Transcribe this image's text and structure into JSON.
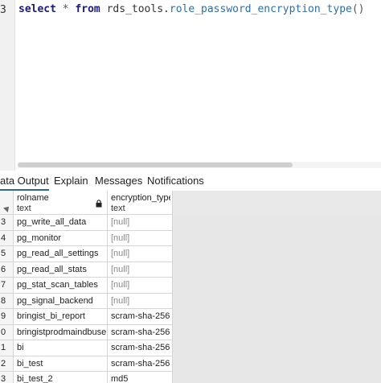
{
  "editor": {
    "line_number": "3",
    "code": {
      "kw_select": "select",
      "star": "*",
      "kw_from": "from",
      "schema": "rds_tools.",
      "func": "role_password_encryption_type",
      "parens": "()"
    }
  },
  "tabs": [
    {
      "label": "ata Output",
      "active": true
    },
    {
      "label": "Explain",
      "active": false
    },
    {
      "label": "Messages",
      "active": false
    },
    {
      "label": "Notifications",
      "active": false
    }
  ],
  "grid": {
    "columns": [
      {
        "name": "rolname",
        "type": "text"
      },
      {
        "name": "encryption_type",
        "type": "text"
      }
    ],
    "rows": [
      {
        "num": "3",
        "rolname": "pg_write_all_data",
        "encryption": "[null]"
      },
      {
        "num": "4",
        "rolname": "pg_monitor",
        "encryption": "[null]"
      },
      {
        "num": "5",
        "rolname": "pg_read_all_settings",
        "encryption": "[null]"
      },
      {
        "num": "6",
        "rolname": "pg_read_all_stats",
        "encryption": "[null]"
      },
      {
        "num": "7",
        "rolname": "pg_stat_scan_tables",
        "encryption": "[null]"
      },
      {
        "num": "8",
        "rolname": "pg_signal_backend",
        "encryption": "[null]"
      },
      {
        "num": "9",
        "rolname": "bringist_bi_report",
        "encryption": "scram-sha-256"
      },
      {
        "num": "0",
        "rolname": "bringistprodmaindbuser",
        "encryption": "scram-sha-256"
      },
      {
        "num": "1",
        "rolname": "bi",
        "encryption": "scram-sha-256"
      },
      {
        "num": "2",
        "rolname": "bi_test",
        "encryption": "scram-sha-256"
      },
      {
        "num": "3",
        "rolname": "bi_test_2",
        "encryption": "md5"
      }
    ]
  },
  "colors": {
    "keyword": "#1a1a7e",
    "function": "#2f6ea5",
    "null_text": "#888888",
    "active_tab_underline": "#326690"
  },
  "icons": [
    "lock-icon",
    "sort-indicator-icon"
  ]
}
